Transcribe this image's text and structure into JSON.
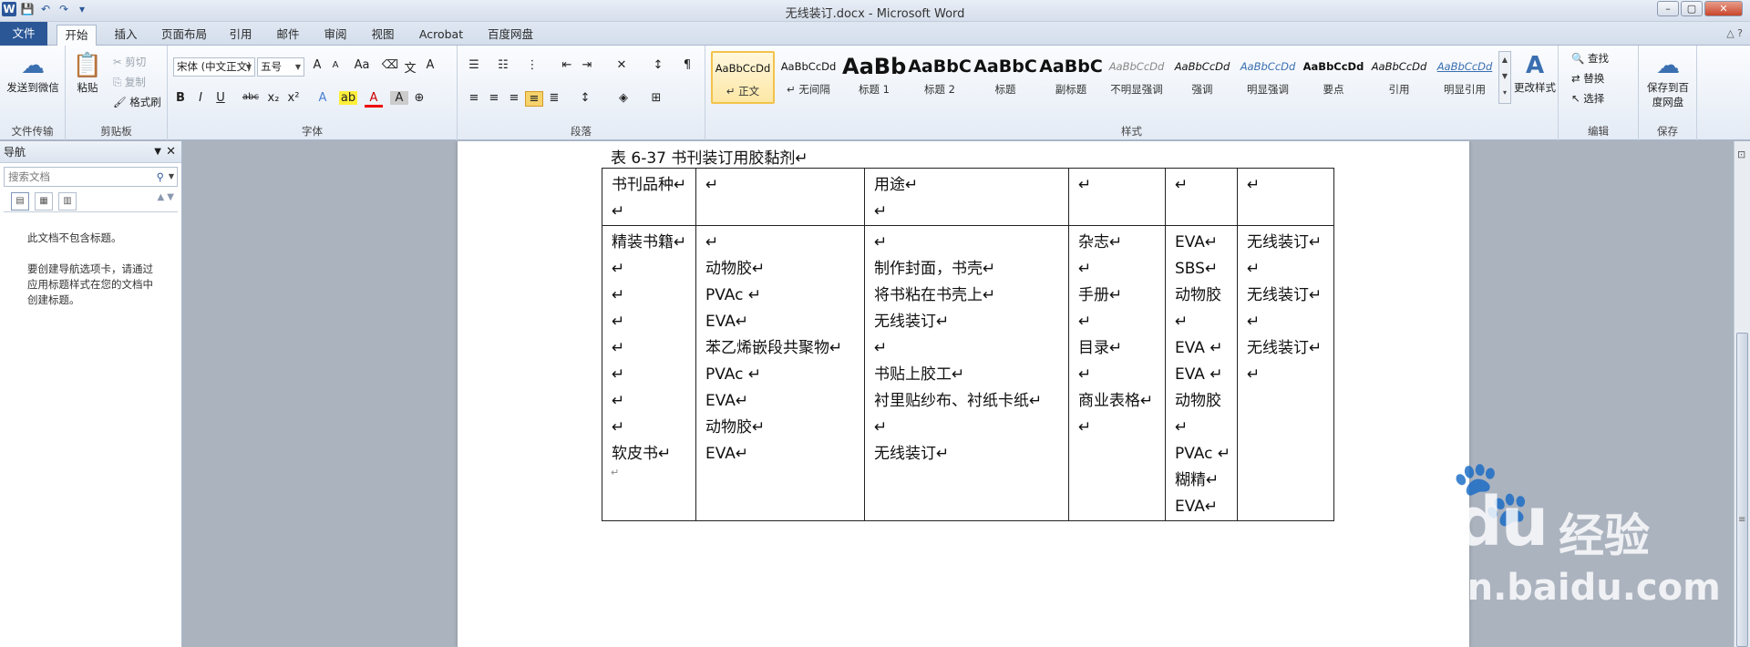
{
  "window": {
    "title": "无线装订.docx - Microsoft Word",
    "min": "–",
    "max": "▢",
    "close": "✕"
  },
  "qat": {
    "word": "W",
    "save": "💾",
    "undo": "↶",
    "redo": "↷",
    "more": "▾"
  },
  "tabs": [
    "文件",
    "开始",
    "插入",
    "页面布局",
    "引用",
    "邮件",
    "审阅",
    "视图",
    "Acrobat",
    "百度网盘"
  ],
  "tabs_right": "△ ?",
  "ribbon": {
    "g1": {
      "btn": "发送到微信",
      "label": "文件传输"
    },
    "clip": {
      "paste": "粘贴",
      "cut": "剪切",
      "copy": "复制",
      "painter": "格式刷",
      "label": "剪贴板"
    },
    "font": {
      "name": "宋体 (中文正文)",
      "size": "五号",
      "grow": "A",
      "shrink": "A",
      "aa": "Aa",
      "b": "B",
      "i": "I",
      "u": "U",
      "abc": "abc",
      "sub": "x₂",
      "sup": "x²",
      "label": "字体"
    },
    "para": {
      "label": "段落"
    },
    "styles": {
      "items": [
        {
          "prev": "AaBbCcDd",
          "name": "↵ 正文"
        },
        {
          "prev": "AaBbCcDd",
          "name": "↵ 无间隔"
        },
        {
          "prev": "AaBb",
          "name": "标题 1"
        },
        {
          "prev": "AaBbC",
          "name": "标题 2"
        },
        {
          "prev": "AaBbC",
          "name": "标题"
        },
        {
          "prev": "AaBbC",
          "name": "副标题"
        },
        {
          "prev": "AaBbCcDd",
          "name": "不明显强调"
        },
        {
          "prev": "AaBbCcDd",
          "name": "强调"
        },
        {
          "prev": "AaBbCcDd",
          "name": "明显强调"
        },
        {
          "prev": "AaBbCcDd",
          "name": "要点"
        },
        {
          "prev": "AaBbCcDd",
          "name": "引用"
        },
        {
          "prev": "AaBbCcDd",
          "name": "明显引用"
        }
      ],
      "change": "更改样式",
      "label": "样式"
    },
    "edit": {
      "find": "查找",
      "replace": "替换",
      "select": "选择",
      "label": "编辑"
    },
    "save": {
      "btn1": "保存到百",
      "btn2": "度网盘",
      "label": "保存"
    }
  },
  "nav": {
    "title": "导航",
    "search_placeholder": "搜索文档",
    "msg1": "此文档不包含标题。",
    "msg2": "要创建导航选项卡，请通过应用标题样式在您的文档中创建标题。"
  },
  "doc": {
    "caption": "表 6-37 书刊装订用胶黏剂↵",
    "header": [
      "书刊品种↵\n↵",
      "↵",
      "用途↵\n↵",
      "↵",
      "↵",
      "↵"
    ],
    "col1": "精装书籍↵\n↵\n↵\n↵\n↵\n↵\n↵\n↵\n软皮书↵",
    "col2": "↵\n动物胶↵\nPVAc ↵\nEVA↵\n苯乙烯嵌段共聚物↵\nPVAc ↵\nEVA↵\n动物胶↵\nEVA↵",
    "col3": "↵\n制作封面，书壳↵\n将书粘在书壳上↵\n无线装订↵\n↵\n书贴上胶工↵\n衬里贴纱布、衬纸卡纸↵\n↵\n无线装订↵",
    "col4": "杂志↵\n↵\n手册↵\n↵\n目录↵\n↵\n商业表格↵\n↵",
    "col5": "EVA↵\nSBS↵\n动物胶↵\nEVA ↵\nEVA ↵\n动物胶↵\nPVAc ↵\n糊精↵\nEVA↵",
    "col6": "无线装订↵\n↵\n无线装订↵\n↵\n无线装订↵\n↵",
    "after": "↵"
  },
  "watermark": {
    "brand": "Baidu",
    "cn": "经验",
    "url": "jingyan.baidu.com",
    "paw": "🐾"
  }
}
